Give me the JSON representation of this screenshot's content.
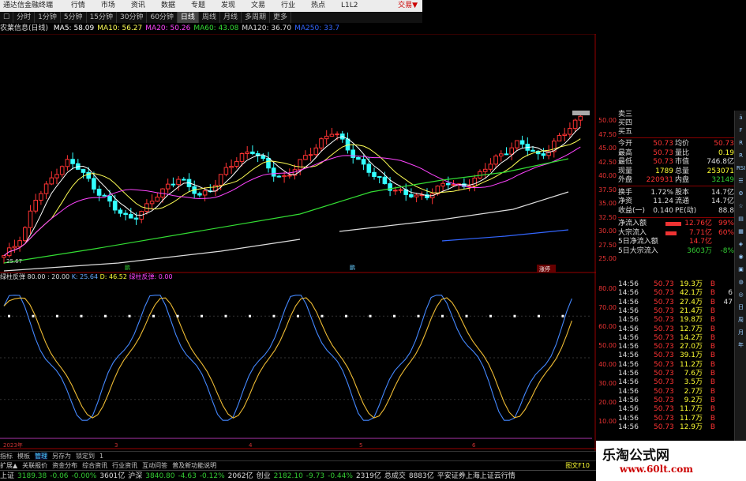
{
  "window": {
    "title": "通达信金融终端",
    "menu": [
      "行情",
      "市场",
      "资讯",
      "数据",
      "专题",
      "发现",
      "文易",
      "行业",
      "热点",
      "L1L2"
    ],
    "right_label": "交易▼"
  },
  "periods": {
    "items": [
      "分时",
      "1分钟",
      "5分钟",
      "15分钟",
      "30分钟",
      "60分钟",
      "日线",
      "周线",
      "月线",
      "多周期",
      "更多"
    ],
    "selected": "日线"
  },
  "ma_legend": {
    "title": "农業信息(日线)",
    "items": [
      {
        "label": "MA5: 58.09",
        "color": "#ffffff"
      },
      {
        "label": "MA10: 56.27",
        "color": "#ffff55"
      },
      {
        "label": "MA20: 50.26",
        "color": "#ff44ff"
      },
      {
        "label": "MA60: 43.08",
        "color": "#33dd33"
      },
      {
        "label": "MA120: 36.70",
        "color": "#dddddd"
      },
      {
        "label": "MA250: 33.7",
        "color": "#3366ff"
      }
    ]
  },
  "price_axis": [
    "50.00",
    "47.50",
    "45.00",
    "42.50",
    "40.00",
    "37.50",
    "35.00",
    "32.50",
    "30.00",
    "27.50",
    "25.00"
  ],
  "price_markers": {
    "low_label": "25.67",
    "m1": "鹏",
    "m2": "鹏",
    "m3": "涨停"
  },
  "indicator_legend": {
    "name": "绿柱反弹",
    "params": "80.00 : 20.00",
    "k": "K: 25.64",
    "d": "D: 46.52",
    "extra": "绿柱反弹: 0.00"
  },
  "indicator_axis": [
    "80.00",
    "70.00",
    "60.00",
    "50.00",
    "40.00",
    "30.00",
    "20.00",
    "10.00"
  ],
  "time_axis": [
    "2023年",
    "3",
    "4",
    "5",
    "6"
  ],
  "bottom_tabs": {
    "items": [
      "指标",
      "模板",
      "管理",
      "另存为",
      "锁定到",
      "1"
    ],
    "selected": "管理"
  },
  "bottom_links": {
    "items": [
      "扩展▲",
      "关联报价",
      "资金分布",
      "综合资讯",
      "行业资讯",
      "互动问答",
      "普及新功能说明"
    ],
    "right": "图文F10"
  },
  "status": [
    {
      "name": "上证",
      "value": "3189.38",
      "chg": "-0.06",
      "pct": "-0.00%",
      "vol": "3601亿"
    },
    {
      "name": "沪深",
      "value": "3840.80",
      "chg": "-4.63",
      "pct": "-0.12%",
      "vol": "2062亿"
    },
    {
      "name": "创业",
      "value": "2182.10",
      "chg": "-9.73",
      "pct": "-0.44%",
      "vol": "2319亿"
    }
  ],
  "status_extra": {
    "label": "总成交",
    "value": "8883亿",
    "broker": "平安证券上海上证云行情"
  },
  "quote": {
    "top": [
      "卖三",
      "买四",
      "买五"
    ],
    "rows": [
      {
        "l1": "今开",
        "v1": "50.73",
        "l2": "均价",
        "v2": "50.73",
        "c1": "up",
        "c2": "up"
      },
      {
        "l1": "最高",
        "v1": "50.73",
        "l2": "量比",
        "v2": "0.19",
        "c1": "up",
        "c2": "yl"
      },
      {
        "l1": "最低",
        "v1": "50.73",
        "l2": "市值",
        "v2": "746.8亿",
        "c1": "up",
        "c2": "wh"
      },
      {
        "l1": "现量",
        "v1": "1789",
        "l2": "总量",
        "v2": "253071",
        "c1": "yl",
        "c2": "yl"
      },
      {
        "l1": "外盘",
        "v1": "220931",
        "l2": "内盘",
        "v2": "32149",
        "c1": "up",
        "c2": "dn"
      },
      {
        "l1": "换手",
        "v1": "1.72%",
        "l2": "股本",
        "v2": "14.7亿",
        "c1": "wh",
        "c2": "wh"
      },
      {
        "l1": "净资",
        "v1": "11.24",
        "l2": "流通",
        "v2": "14.7亿",
        "c1": "wh",
        "c2": "wh"
      },
      {
        "l1": "收益(一)",
        "v1": "0.140",
        "l2": "PE(动)",
        "v2": "88.8",
        "c1": "wh",
        "c2": "wh"
      }
    ],
    "flows": [
      {
        "label": "净流入额",
        "value": "12.76亿",
        "pct": "99%"
      },
      {
        "label": "大宗流入",
        "value": "7.71亿",
        "pct": "60%"
      },
      {
        "label": "5日净流入额",
        "value": "14.7亿",
        "pct": ""
      },
      {
        "label": "5日大宗流入",
        "value": "3603万",
        "pct": "-8%"
      }
    ]
  },
  "ticks": [
    {
      "t": "14:56",
      "p": "50.73",
      "v": "19.3万",
      "s": "B",
      "n": ""
    },
    {
      "t": "14:56",
      "p": "50.73",
      "v": "42.1万",
      "s": "B",
      "n": "6"
    },
    {
      "t": "14:56",
      "p": "50.73",
      "v": "27.4万",
      "s": "B",
      "n": "47"
    },
    {
      "t": "14:56",
      "p": "50.73",
      "v": "21.4万",
      "s": "B",
      "n": ""
    },
    {
      "t": "14:56",
      "p": "50.73",
      "v": "19.8万",
      "s": "B",
      "n": ""
    },
    {
      "t": "14:56",
      "p": "50.73",
      "v": "12.7万",
      "s": "B",
      "n": ""
    },
    {
      "t": "14:56",
      "p": "50.73",
      "v": "14.2万",
      "s": "B",
      "n": ""
    },
    {
      "t": "14:56",
      "p": "50.73",
      "v": "27.0万",
      "s": "B",
      "n": ""
    },
    {
      "t": "14:56",
      "p": "50.73",
      "v": "39.1万",
      "s": "B",
      "n": ""
    },
    {
      "t": "14:56",
      "p": "50.73",
      "v": "11.2万",
      "s": "B",
      "n": ""
    },
    {
      "t": "14:56",
      "p": "50.73",
      "v": "7.6万",
      "s": "B",
      "n": ""
    },
    {
      "t": "14:56",
      "p": "50.73",
      "v": "3.5万",
      "s": "B",
      "n": ""
    },
    {
      "t": "14:56",
      "p": "50.73",
      "v": "2.7万",
      "s": "B",
      "n": ""
    },
    {
      "t": "14:56",
      "p": "50.73",
      "v": "9.2万",
      "s": "B",
      "n": ""
    },
    {
      "t": "14:56",
      "p": "50.73",
      "v": "11.7万",
      "s": "B",
      "n": ""
    },
    {
      "t": "14:56",
      "p": "50.73",
      "v": "11.7万",
      "s": "B",
      "n": ""
    },
    {
      "t": "14:56",
      "p": "50.73",
      "v": "12.9万",
      "s": "B",
      "n": ""
    }
  ],
  "sidebar": [
    "ā",
    "F",
    "R",
    "R",
    "RSI",
    "☰",
    "⚙",
    "☆",
    "▤",
    "▦",
    "◈",
    "◉",
    "▣",
    "◍",
    "◎",
    "日",
    "周",
    "月",
    "年"
  ],
  "watermark": {
    "line1": "乐淘公式网",
    "line2": "www.60lt.com"
  }
}
